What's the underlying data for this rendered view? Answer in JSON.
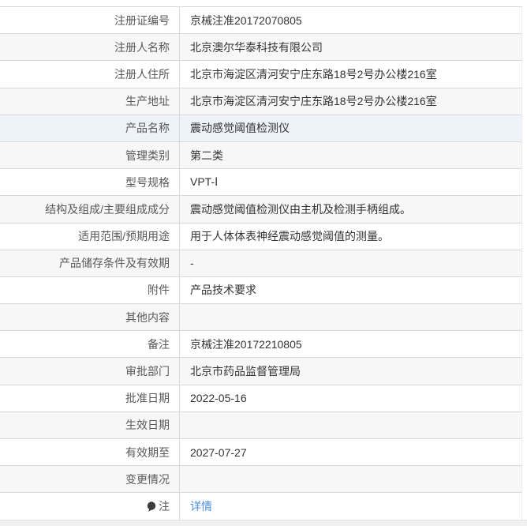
{
  "table": {
    "rows": [
      {
        "label": "注册证编号",
        "value": "京械注准20172070805"
      },
      {
        "label": "注册人名称",
        "value": "北京澳尔华泰科技有限公司"
      },
      {
        "label": "注册人住所",
        "value": "北京市海淀区清河安宁庄东路18号2号办公楼216室"
      },
      {
        "label": "生产地址",
        "value": "北京市海淀区清河安宁庄东路18号2号办公楼216室"
      },
      {
        "label": "产品名称",
        "value": "震动感觉阈值检测仪"
      },
      {
        "label": "管理类别",
        "value": "第二类"
      },
      {
        "label": "型号规格",
        "value": "VPT-Ⅰ"
      },
      {
        "label": "结构及组成/主要组成成分",
        "value": "震动感觉阈值检测仪由主机及检测手柄组成。"
      },
      {
        "label": "适用范围/预期用途",
        "value": "用于人体体表神经震动感觉阈值的测量。"
      },
      {
        "label": "产品储存条件及有效期",
        "value": "-"
      },
      {
        "label": "附件",
        "value": "产品技术要求"
      },
      {
        "label": "其他内容",
        "value": ""
      },
      {
        "label": "备注",
        "value": "京械注准20172210805"
      },
      {
        "label": "审批部门",
        "value": "北京市药品监督管理局"
      },
      {
        "label": "批准日期",
        "value": "2022-05-16"
      },
      {
        "label": "生效日期",
        "value": ""
      },
      {
        "label": "有效期至",
        "value": "2027-07-27"
      },
      {
        "label": "变更情况",
        "value": ""
      },
      {
        "label": "注",
        "value": "详情",
        "value_type": "link",
        "icon": "note-balloon-icon"
      }
    ]
  },
  "colors": {
    "link": "#4a90e2",
    "stripe": "#f7f7f7",
    "hover_row": "#eef3f9",
    "border": "#d9d9d9",
    "label_text": "#595959",
    "value_text": "#333333"
  }
}
